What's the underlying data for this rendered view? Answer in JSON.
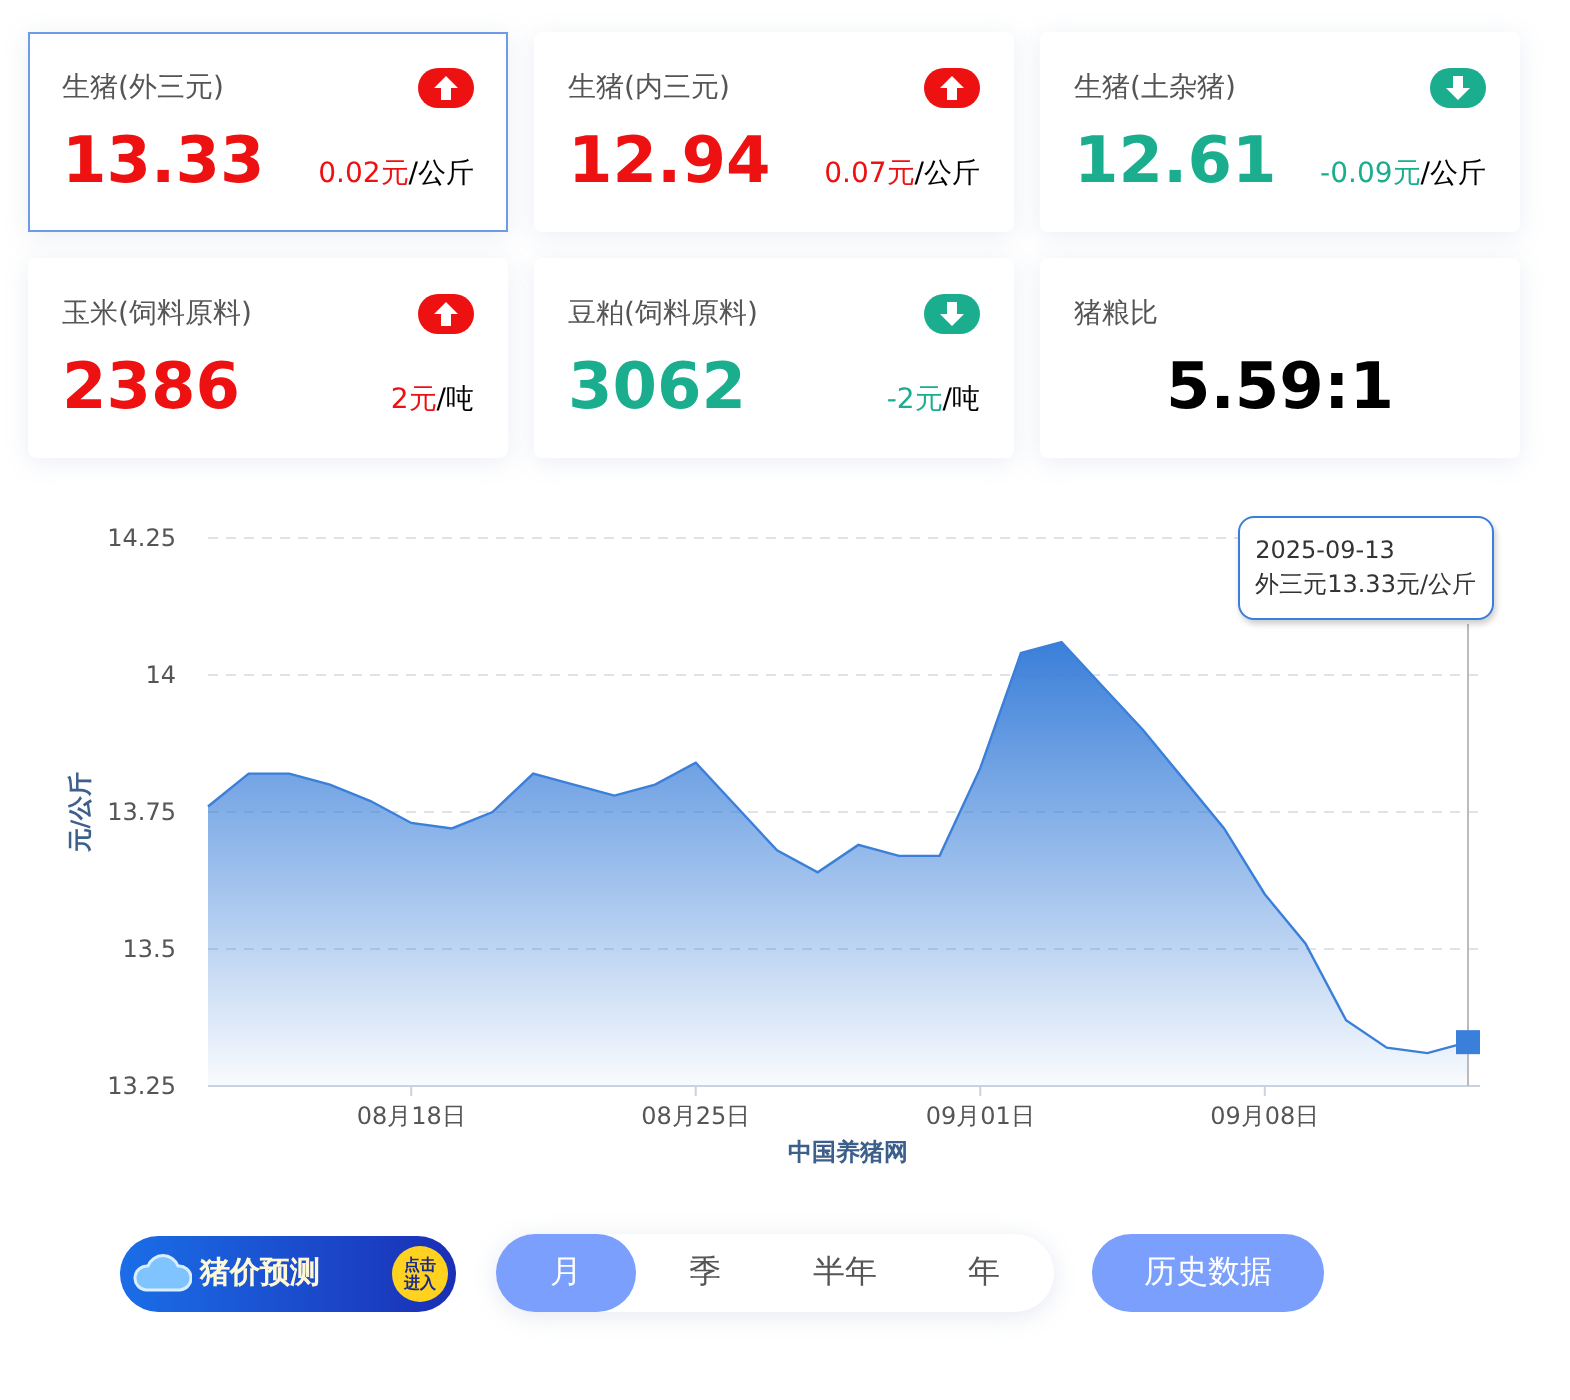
{
  "cards": [
    {
      "kind": "price",
      "name": "生猪(外三元)",
      "value": "13.33",
      "change": "0.02元",
      "unit": "/公斤",
      "rising": true,
      "selected": true
    },
    {
      "kind": "price",
      "name": "生猪(内三元)",
      "value": "12.94",
      "change": "0.07元",
      "unit": "/公斤",
      "rising": true,
      "selected": false
    },
    {
      "kind": "price",
      "name": "生猪(土杂猪)",
      "value": "12.61",
      "change": "-0.09元",
      "unit": "/公斤",
      "rising": false,
      "selected": false
    },
    {
      "kind": "price",
      "name": "玉米(饲料原料)",
      "value": "2386",
      "change": "2元",
      "unit": "/吨",
      "rising": true,
      "selected": false
    },
    {
      "kind": "price",
      "name": "豆粕(饲料原料)",
      "value": "3062",
      "change": "-2元",
      "unit": "/吨",
      "rising": false,
      "selected": false
    },
    {
      "kind": "ratio",
      "name": "猪粮比",
      "value": "5.59:1",
      "selected": false
    }
  ],
  "chart": {
    "chart_data": {
      "type": "area",
      "xlabel": "中国养猪网",
      "ylabel": "元/公斤",
      "categories": [
        null,
        null,
        null,
        null,
        null,
        "08月18日",
        null,
        null,
        null,
        null,
        null,
        null,
        "08月25日",
        null,
        null,
        null,
        null,
        null,
        null,
        "09月01日",
        null,
        null,
        null,
        null,
        null,
        null,
        "09月08日",
        null,
        null,
        null,
        null,
        null
      ],
      "grid": true,
      "series": [
        {
          "color": "#3a7fd9",
          "values": [
            13.76,
            13.82,
            13.82,
            13.8,
            13.77,
            13.73,
            13.72,
            13.75,
            13.82,
            13.8,
            13.78,
            13.8,
            13.84,
            13.76,
            13.68,
            13.64,
            13.69,
            13.67,
            13.67,
            13.83,
            14.04,
            14.06,
            13.98,
            13.9,
            13.81,
            13.72,
            13.6,
            13.51,
            13.37,
            13.32,
            13.31,
            13.33
          ]
        }
      ],
      "ylim": [
        13.25,
        14.25
      ],
      "yticks": [
        {
          "value": 13.25,
          "label": "13.25"
        },
        {
          "value": 13.5,
          "label": "13.5"
        },
        {
          "value": 13.75,
          "label": "13.75"
        },
        {
          "value": 14,
          "label": "14"
        },
        {
          "value": 14.25,
          "label": "14.25"
        }
      ]
    },
    "tooltip": {
      "date": "2025-09-13",
      "text": "外三元13.33元/公斤"
    }
  },
  "banner": {
    "title": "猪价预测",
    "badge_line_1": "点击",
    "badge_line_2": "进入"
  },
  "periods": [
    {
      "label": "月",
      "selected": true
    },
    {
      "label": "季",
      "selected": false
    },
    {
      "label": "半年",
      "selected": false
    },
    {
      "label": "年",
      "selected": false
    }
  ],
  "history_button": "历史数据"
}
